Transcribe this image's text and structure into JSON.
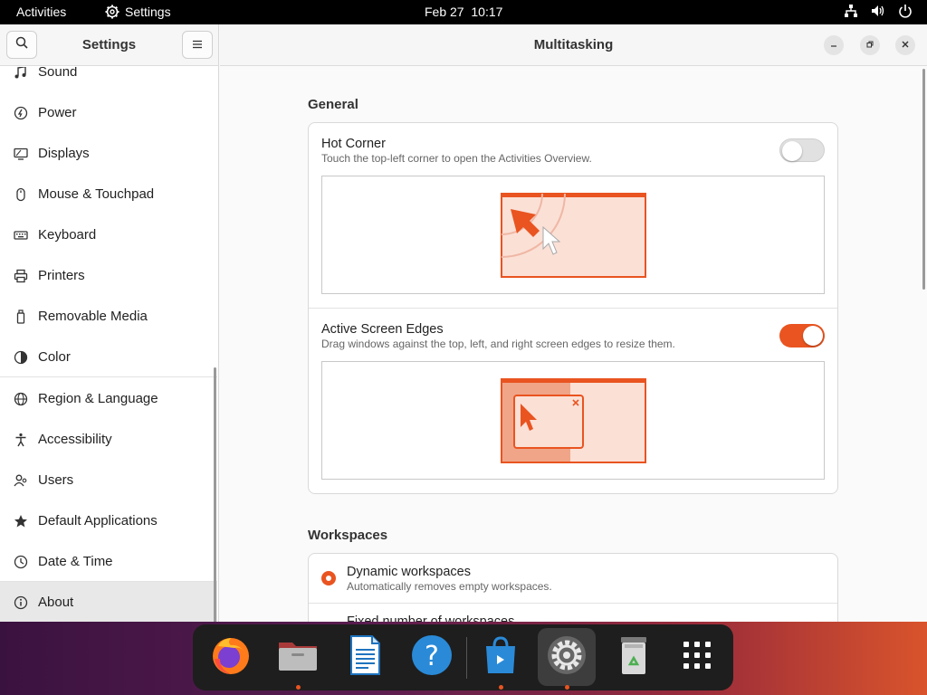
{
  "topbar": {
    "activities": "Activities",
    "app_name": "Settings",
    "date": "Feb 27",
    "time": "10:17",
    "tray_icons": [
      "network-icon",
      "volume-icon",
      "power-icon"
    ]
  },
  "sidebar": {
    "title": "Settings",
    "items": [
      {
        "label": "Sound",
        "icon": "music-note-icon"
      },
      {
        "label": "Power",
        "icon": "power-icon"
      },
      {
        "label": "Displays",
        "icon": "display-icon"
      },
      {
        "label": "Mouse & Touchpad",
        "icon": "mouse-icon"
      },
      {
        "label": "Keyboard",
        "icon": "keyboard-icon"
      },
      {
        "label": "Printers",
        "icon": "printer-icon"
      },
      {
        "label": "Removable Media",
        "icon": "usb-drive-icon"
      },
      {
        "label": "Color",
        "icon": "color-icon"
      },
      {
        "label": "Region & Language",
        "icon": "globe-icon"
      },
      {
        "label": "Accessibility",
        "icon": "accessibility-icon"
      },
      {
        "label": "Users",
        "icon": "users-icon"
      },
      {
        "label": "Default Applications",
        "icon": "star-icon"
      },
      {
        "label": "Date & Time",
        "icon": "clock-icon"
      },
      {
        "label": "About",
        "icon": "info-icon"
      }
    ]
  },
  "main": {
    "title": "Multitasking",
    "general": {
      "title": "General",
      "hot_corner": {
        "title": "Hot Corner",
        "subtitle": "Touch the top-left corner to open the Activities Overview.",
        "enabled": false
      },
      "active_edges": {
        "title": "Active Screen Edges",
        "subtitle": "Drag windows against the top, left, and right screen edges to resize them.",
        "enabled": true
      }
    },
    "workspaces": {
      "title": "Workspaces",
      "dynamic": {
        "title": "Dynamic workspaces",
        "subtitle": "Automatically removes empty workspaces.",
        "selected": true
      },
      "fixed": {
        "title": "Fixed number of workspaces"
      }
    }
  },
  "dock": {
    "apps": [
      {
        "name": "firefox-icon",
        "running": false
      },
      {
        "name": "files-icon",
        "running": true
      },
      {
        "name": "writer-icon",
        "running": false
      },
      {
        "name": "help-icon",
        "running": false
      },
      {
        "name": "software-icon",
        "running": true
      },
      {
        "name": "settings-icon",
        "running": true
      },
      {
        "name": "trash-icon",
        "running": false
      },
      {
        "name": "app-grid-icon",
        "running": false
      }
    ]
  },
  "colors": {
    "accent": "#e95420",
    "preview_bg": "#fbe0d6"
  }
}
